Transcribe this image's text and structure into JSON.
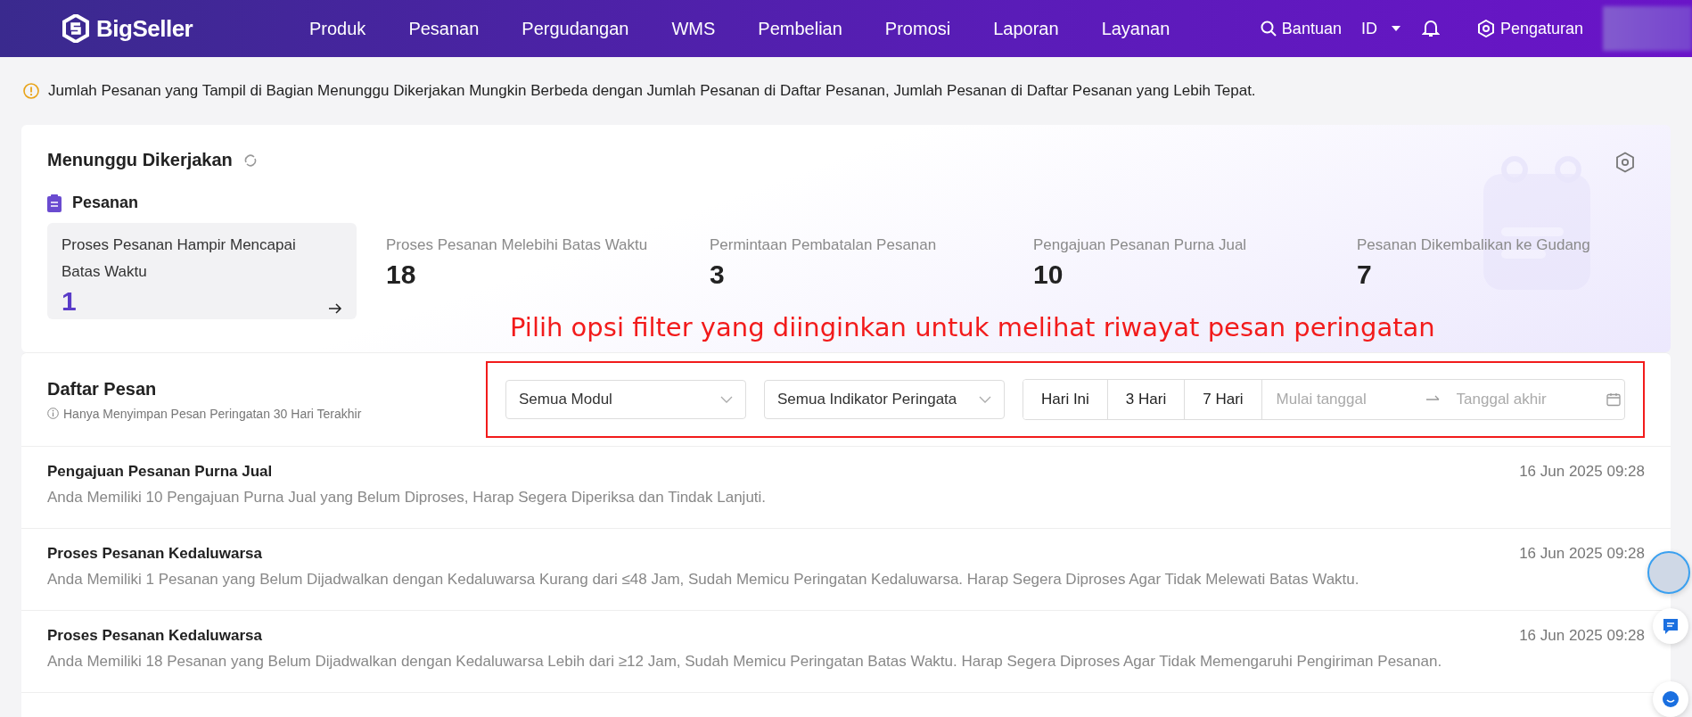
{
  "nav": {
    "logo": "BigSeller",
    "menu": [
      "Produk",
      "Pesanan",
      "Pergudangan",
      "WMS",
      "Pembelian",
      "Promosi",
      "Laporan",
      "Layanan"
    ],
    "help": "Bantuan",
    "language": "ID",
    "settings": "Pengaturan"
  },
  "notice": "Jumlah Pesanan yang Tampil di Bagian Menunggu Dikerjakan Mungkin Berbeda dengan Jumlah Pesanan di Daftar Pesanan, Jumlah Pesanan di Daftar Pesanan yang Lebih Tepat.",
  "pending": {
    "title": "Menunggu Dikerjakan",
    "section": "Pesanan",
    "stats": [
      {
        "label": "Proses Pesanan Hampir Mencapai Batas Waktu",
        "value": "1",
        "selected": true
      },
      {
        "label": "Proses Pesanan Melebihi Batas Waktu",
        "value": "18",
        "selected": false
      },
      {
        "label": "Permintaan Pembatalan Pesanan",
        "value": "3",
        "selected": false
      },
      {
        "label": "Pengajuan Pesanan Purna Jual",
        "value": "10",
        "selected": false
      },
      {
        "label": "Pesanan Dikembalikan ke Gudang",
        "value": "7",
        "selected": false
      }
    ]
  },
  "annotation": "Pilih opsi filter yang diinginkan untuk melihat riwayat pesan peringatan",
  "messages": {
    "title": "Daftar Pesan",
    "hint": "Hanya Menyimpan Pesan Peringatan 30 Hari Terakhir",
    "filters": {
      "module": "Semua Modul",
      "indicator": "Semua Indikator Peringata",
      "ranges": [
        "Hari Ini",
        "3 Hari",
        "7 Hari"
      ],
      "start_placeholder": "Mulai tanggal",
      "end_placeholder": "Tanggal akhir"
    },
    "rows": [
      {
        "title": "Pengajuan Pesanan Purna Jual",
        "time": "16 Jun 2025 09:28",
        "text": "Anda Memiliki 10 Pengajuan Purna Jual yang Belum Diproses, Harap Segera Diperiksa dan Tindak Lanjuti."
      },
      {
        "title": "Proses Pesanan Kedaluwarsa",
        "time": "16 Jun 2025 09:28",
        "text": "Anda Memiliki 1 Pesanan yang Belum Dijadwalkan dengan Kedaluwarsa Kurang dari ≤48 Jam, Sudah Memicu Peringatan Kedaluwarsa. Harap Segera Diproses Agar Tidak Melewati Batas Waktu."
      },
      {
        "title": "Proses Pesanan Kedaluwarsa",
        "time": "16 Jun 2025 09:28",
        "text": "Anda Memiliki 18 Pesanan yang Belum Dijadwalkan dengan Kedaluwarsa Lebih dari ≥12 Jam, Sudah Memicu Peringatan Batas Waktu. Harap Segera Diproses Agar Tidak Memengaruhi Pengiriman Pesanan."
      }
    ]
  }
}
